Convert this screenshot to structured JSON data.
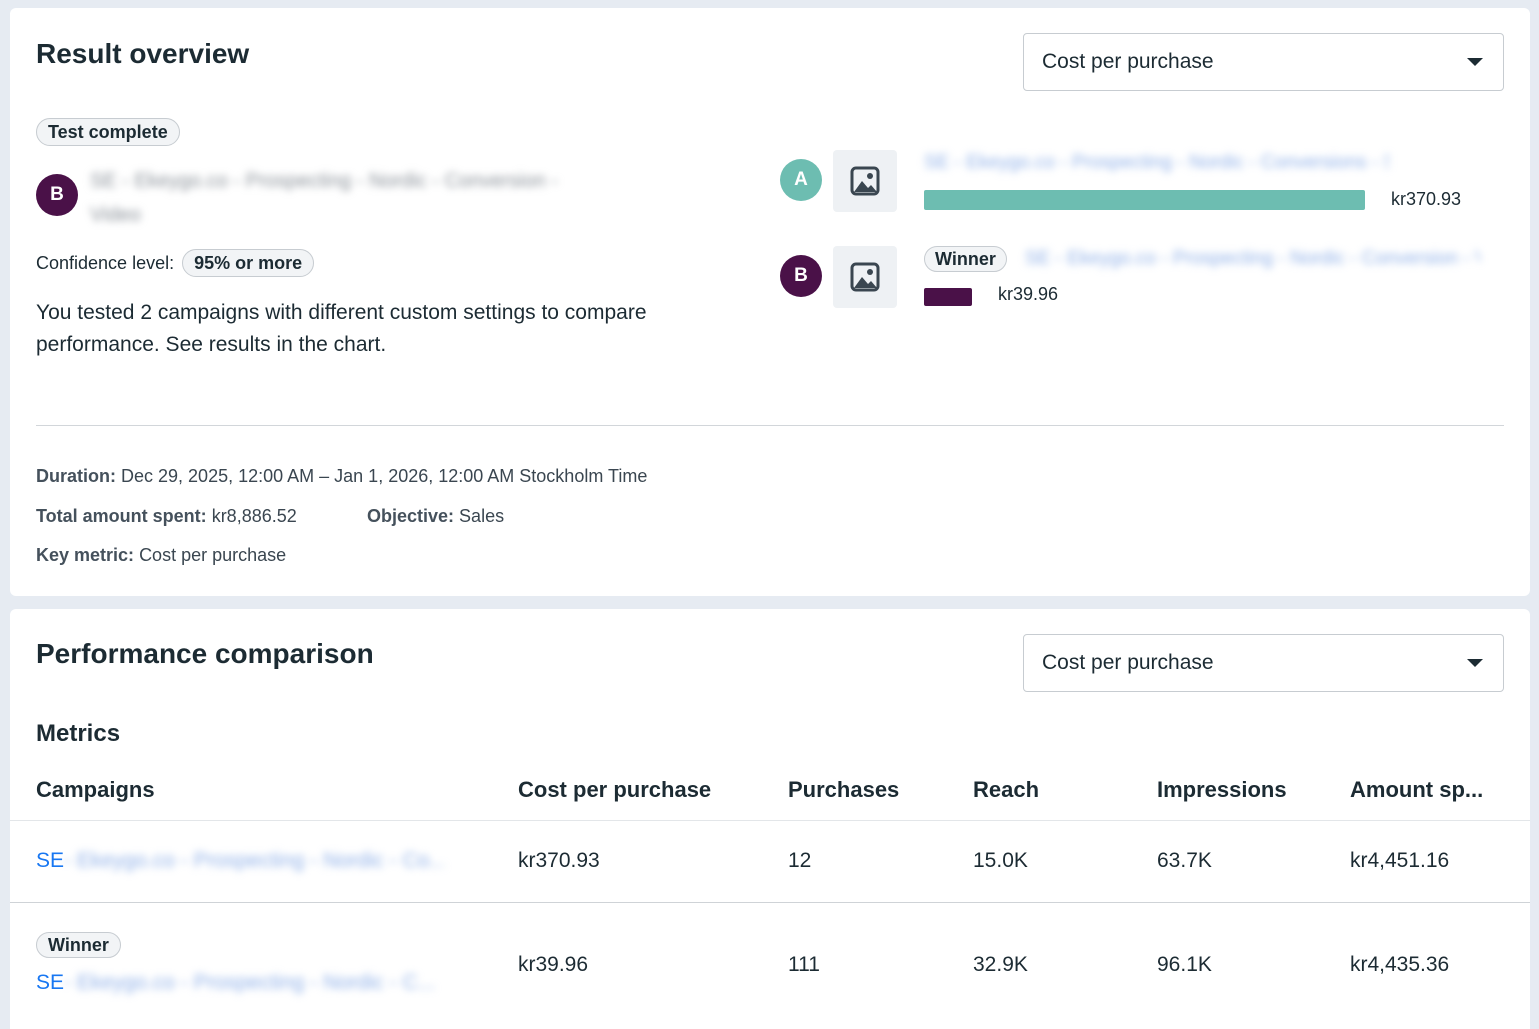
{
  "result_overview": {
    "title": "Result overview",
    "metric_select": {
      "selected": "Cost per purchase"
    },
    "status_badge": "Test complete",
    "winner_avatar": "B",
    "winner_name": "SE - Ekeygo.co - Prospecting - Nordic - Conversion - Video",
    "confidence_label": "Confidence level:",
    "confidence_value": "95% or more",
    "description": "You tested 2 campaigns with different custom settings to compare performance. See results in the chart.",
    "chart": {
      "campaigns": [
        {
          "letter": "A",
          "name": "SE - Ekeygo.co - Prospecting - Nordic - Conversions - Static",
          "value_label": "kr370.93",
          "value": 370.93,
          "color": "#6dbdb1",
          "winner": false
        },
        {
          "letter": "B",
          "name": "SE - Ekeygo.co - Prospecting - Nordic - Conversion - Video",
          "value_label": "kr39.96",
          "value": 39.96,
          "color": "#4a1148",
          "winner": true,
          "winner_label": "Winner"
        }
      ]
    },
    "duration_label": "Duration:",
    "duration_value": "Dec 29, 2025, 12:00 AM – Jan 1, 2026, 12:00 AM Stockholm Time",
    "spent_label": "Total amount spent:",
    "spent_value": "kr8,886.52",
    "objective_label": "Objective:",
    "objective_value": "Sales",
    "key_metric_label": "Key metric:",
    "key_metric_value": "Cost per purchase"
  },
  "performance_comparison": {
    "title": "Performance comparison",
    "metric_select": {
      "selected": "Cost per purchase"
    },
    "metrics_heading": "Metrics",
    "columns": [
      "Campaigns",
      "Cost per purchase",
      "Purchases",
      "Reach",
      "Impressions",
      "Amount sp..."
    ],
    "rows": [
      {
        "campaign_prefix": "SE",
        "campaign_rest": "- Ekeygo.co - Prospecting - Nordic - Co...",
        "winner": false,
        "cost_per_purchase": "kr370.93",
        "purchases": "12",
        "reach": "15.0K",
        "impressions": "63.7K",
        "amount_spent": "kr4,451.16"
      },
      {
        "campaign_prefix": "SE",
        "campaign_rest": "- Ekeygo.co - Prospecting - Nordic - C...",
        "winner": true,
        "winner_label": "Winner",
        "cost_per_purchase": "kr39.96",
        "purchases": "111",
        "reach": "32.9K",
        "impressions": "96.1K",
        "amount_spent": "kr4,435.36"
      }
    ]
  }
}
